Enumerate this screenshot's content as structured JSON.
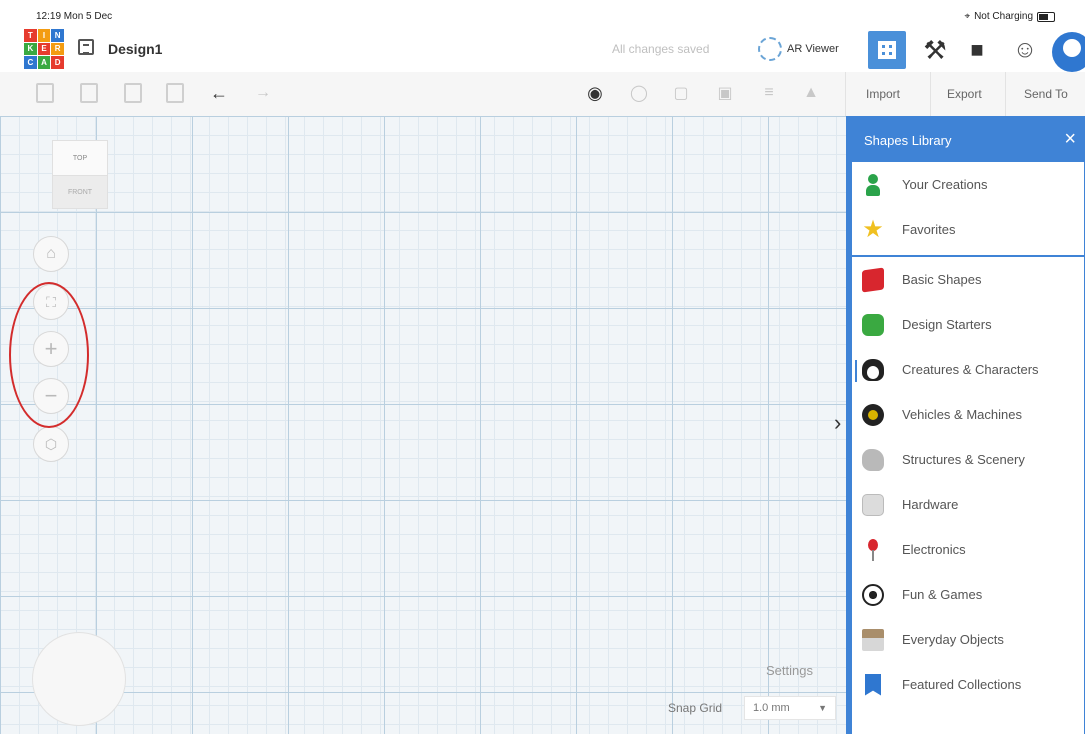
{
  "status_bar": {
    "time": "12:19  Mon 5 Dec",
    "charging": "Not Charging"
  },
  "app": {
    "logo_letters": [
      "T",
      "I",
      "N",
      "K",
      "E",
      "R",
      "C",
      "A",
      "D"
    ],
    "logo_colors": [
      "#e63b2e",
      "#f39c12",
      "#2f77d0",
      "#3aa941",
      "#e63b2e",
      "#f39c12",
      "#2f77d0",
      "#3aa941",
      "#e63b2e"
    ],
    "design_title": "Design1",
    "saved_status": "All changes saved",
    "ar_viewer_label": "AR Viewer"
  },
  "toolbar": {
    "import_label": "Import",
    "export_label": "Export",
    "send_to_label": "Send To"
  },
  "viewcube": {
    "top_label": "TOP",
    "front_label": "FRONT"
  },
  "canvas": {
    "settings_label": "Settings",
    "snap_grid_label": "Snap Grid",
    "snap_grid_value": "1.0 mm"
  },
  "shapes_library": {
    "title": "Shapes Library",
    "personal": [
      {
        "label": "Your Creations",
        "icon": "person-icon"
      },
      {
        "label": "Favorites",
        "icon": "star-icon"
      }
    ],
    "categories": [
      {
        "label": "Basic Shapes",
        "icon": "red-cube-icon"
      },
      {
        "label": "Design Starters",
        "icon": "green-cube-icon"
      },
      {
        "label": "Creatures & Characters",
        "icon": "penguin-icon"
      },
      {
        "label": "Vehicles & Machines",
        "icon": "wheel-icon"
      },
      {
        "label": "Structures & Scenery",
        "icon": "rock-icon"
      },
      {
        "label": "Hardware",
        "icon": "nut-icon"
      },
      {
        "label": "Electronics",
        "icon": "pin-icon"
      },
      {
        "label": "Fun & Games",
        "icon": "soccer-ball-icon"
      },
      {
        "label": "Everyday Objects",
        "icon": "lamp-icon"
      },
      {
        "label": "Featured Collections",
        "icon": "bookmark-icon"
      }
    ]
  },
  "colors": {
    "accent": "#3f83d6",
    "annotation": "#d32c2c"
  }
}
